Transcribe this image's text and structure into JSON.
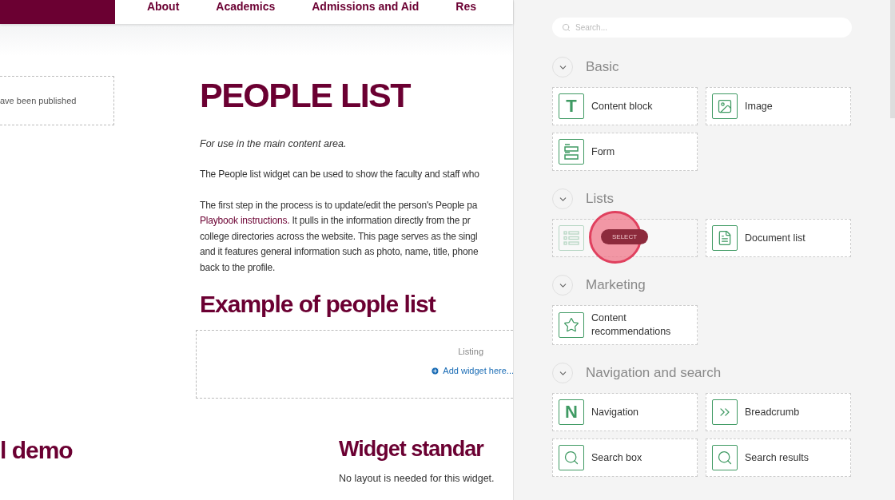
{
  "page": {
    "nav": [
      "About",
      "Academics",
      "Admissions and Aid",
      "Res"
    ],
    "side_note": "ave been published",
    "title": "PEOPLE LIST",
    "intro": "For use in the main content area.",
    "paragraphs": [
      {
        "lines": [
          {
            "text": "The People list widget can be used to show the faculty and staff who"
          }
        ]
      },
      {
        "lines": [
          {
            "text": "The first step in the process is to update/edit the person's People pa"
          },
          {
            "link": "Playbook instructions.",
            "text": " It pulls in the information directly from the pr"
          },
          {
            "text": "college directories across the website. This page serves as the singl"
          },
          {
            "text": "and it features general information such as photo, name, title, phone"
          },
          {
            "text": "back to the profile."
          }
        ]
      }
    ],
    "example_heading": "Example of people list",
    "zone": {
      "label": "Listing",
      "add": "Add widget here..."
    },
    "demo_heading": "l demo",
    "standards_heading": "Widget standar",
    "standards_text": "No layout is needed for this widget."
  },
  "panel": {
    "search": {
      "placeholder": "Search..."
    },
    "sections": [
      {
        "title": "Basic",
        "expanded": true,
        "widgets": [
          {
            "kind": "text",
            "glyph": "T",
            "label": "Content block",
            "hovered": false
          },
          {
            "kind": "image",
            "label": "Image",
            "hovered": false
          },
          {
            "kind": "form",
            "label": "Form",
            "hovered": false
          }
        ]
      },
      {
        "title": "Lists",
        "expanded": true,
        "widgets": [
          {
            "kind": "list",
            "hovered": true,
            "badge": "SELECT"
          },
          {
            "kind": "document",
            "label": "Document list",
            "hovered": false
          }
        ]
      },
      {
        "title": "Marketing",
        "expanded": true,
        "widgets": [
          {
            "kind": "star",
            "label": "Content recommendations",
            "hovered": false
          }
        ]
      },
      {
        "title": "Navigation and search",
        "expanded": true,
        "widgets": [
          {
            "kind": "text",
            "glyph": "N",
            "label": "Navigation",
            "hovered": false
          },
          {
            "kind": "chevrons",
            "label": "Breadcrumb",
            "hovered": false
          },
          {
            "kind": "search",
            "label": "Search box",
            "hovered": false
          },
          {
            "kind": "search",
            "label": "Search results",
            "hovered": false
          }
        ]
      }
    ]
  }
}
